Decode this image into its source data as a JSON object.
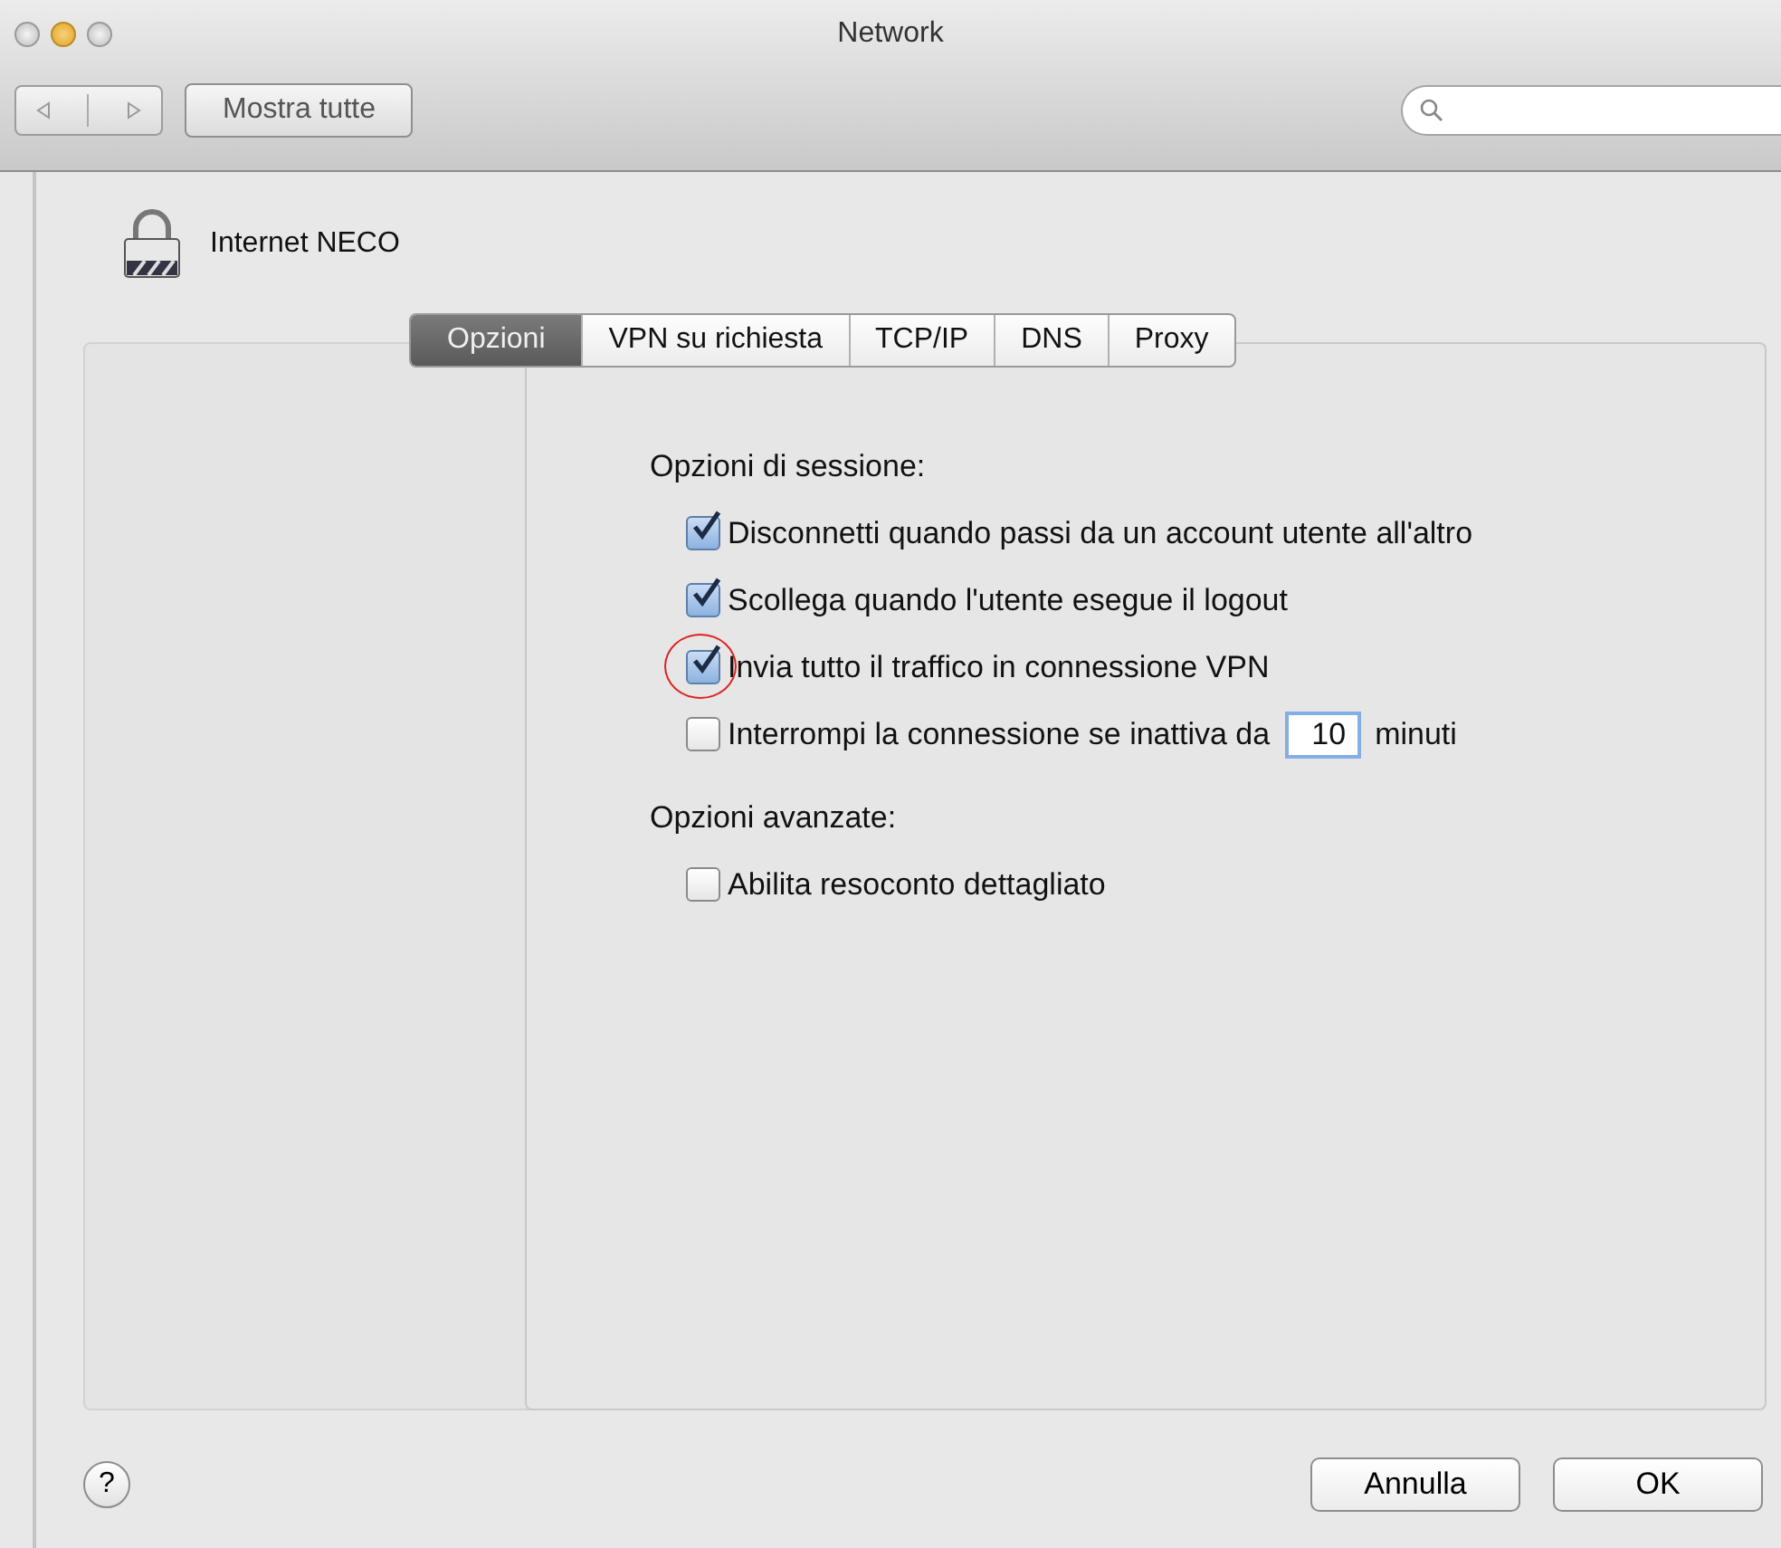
{
  "window": {
    "title": "Network"
  },
  "toolbar": {
    "show_all_button": "Mostra tutte"
  },
  "connection": {
    "name": "Internet NECO"
  },
  "sheet": {
    "tabs": [
      {
        "label": "Opzioni",
        "selected": true
      },
      {
        "label": "VPN su richiesta",
        "selected": false
      },
      {
        "label": "TCP/IP",
        "selected": false
      },
      {
        "label": "DNS",
        "selected": false
      },
      {
        "label": "Proxy",
        "selected": false
      }
    ],
    "sections": [
      {
        "title": "Opzioni di sessione:",
        "options": [
          {
            "kind": "check",
            "label": "Disconnetti quando passi da un account utente all'altro",
            "checked": true,
            "circled": false
          },
          {
            "kind": "check",
            "label": "Scollega quando l'utente esegue il logout",
            "checked": true,
            "circled": false
          },
          {
            "kind": "check",
            "label": "Invia tutto il traffico in connessione VPN",
            "checked": true,
            "circled": true
          },
          {
            "kind": "timeout",
            "label": "Interrompi la connessione se inattiva da",
            "checked": false,
            "circled": false,
            "value": "10",
            "unit": "minuti"
          }
        ]
      },
      {
        "title": "Opzioni avanzate:",
        "options": [
          {
            "kind": "check",
            "label": "Abilita resoconto dettagliato",
            "checked": false,
            "circled": false
          }
        ]
      }
    ],
    "help_button": "?",
    "buttons": [
      "Annulla",
      "OK"
    ]
  }
}
